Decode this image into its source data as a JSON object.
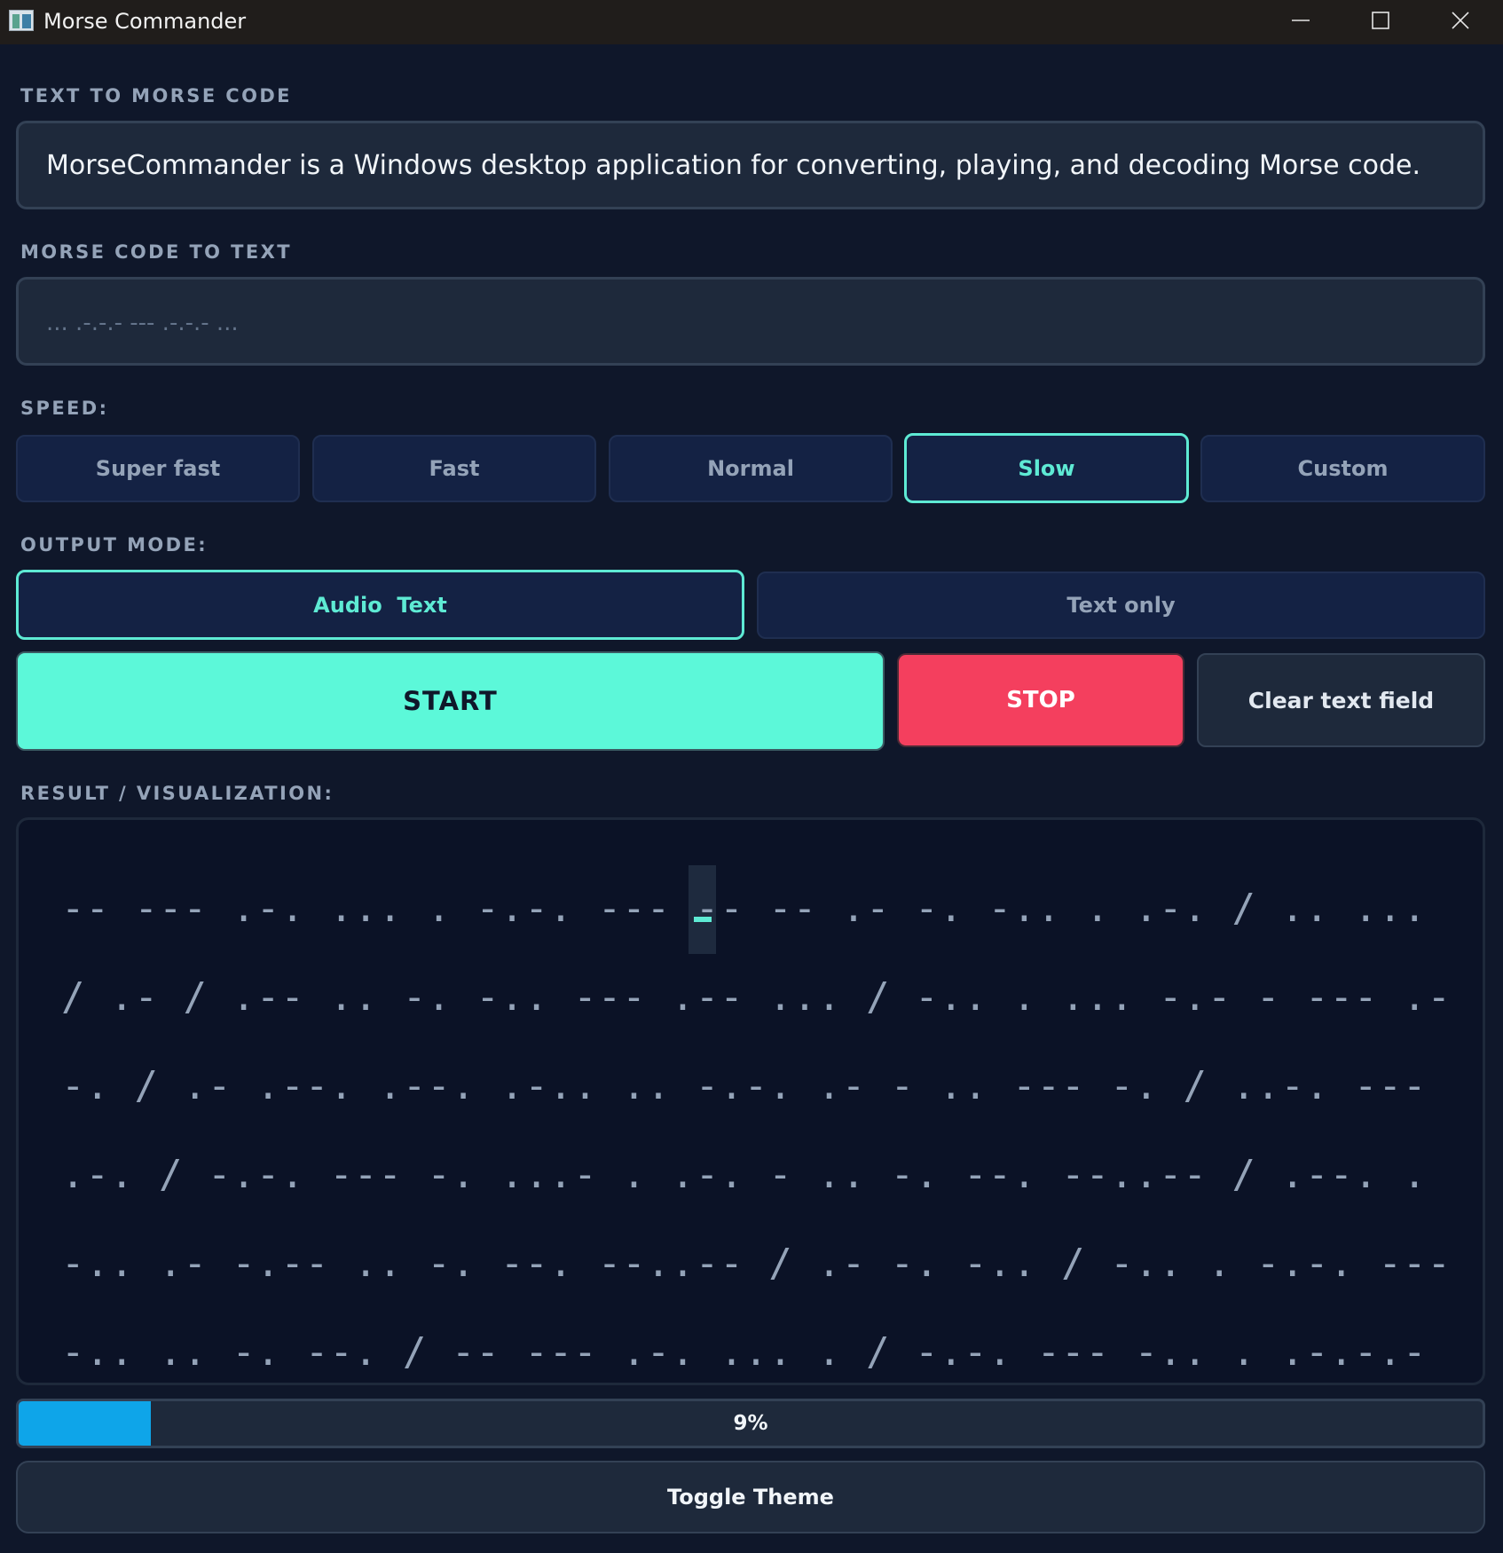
{
  "window": {
    "title": "Morse Commander"
  },
  "text_to_morse": {
    "label": "TEXT TO MORSE CODE",
    "value": "MorseCommander is a Windows desktop application for converting, playing, and decoding Morse code."
  },
  "morse_to_text": {
    "label": "MORSE CODE TO TEXT",
    "placeholder": "... .-.-.- --- .-.-.- ..."
  },
  "speed": {
    "label": "SPEED:",
    "options": [
      "Super fast",
      "Fast",
      "Normal",
      "Slow",
      "Custom"
    ],
    "selected": "Slow"
  },
  "output_mode": {
    "label": "OUTPUT MODE:",
    "options": [
      "Audio  Text",
      "Text only"
    ],
    "selected": "Audio  Text"
  },
  "actions": {
    "start": "START",
    "stop": "STOP",
    "clear": "Clear text field"
  },
  "result": {
    "label": "RESULT / VISUALIZATION:",
    "morse": "-- --- .-. ... . -.-. --- -- -- .- -. -.. . .-. / .. ... / .- / .-- .. -. -.. --- .-- ... / -.. . ... -.- - --- .--. / .- .--. .--. .-.. .. -.-. .- - .. --- -. / ..-. --- .-. / -.-. --- -. ...- . .-. - .. -. --. --..-- / .--. .-.. .- -.-- .. -. --. --..-- / .- -. -.. / -.. . -.-. --- -.. .. -. --. / -- --- .-. ... . / -.-. --- -.. . .-.-.-"
  },
  "progress": {
    "percent": 9,
    "text": "9%",
    "color": "#0ea5e9"
  },
  "toggle_theme": "Toggle Theme",
  "colors": {
    "accent": "#5eead4",
    "start": "#5cf8d9",
    "stop": "#f43f5e",
    "background": "#0f172a"
  }
}
